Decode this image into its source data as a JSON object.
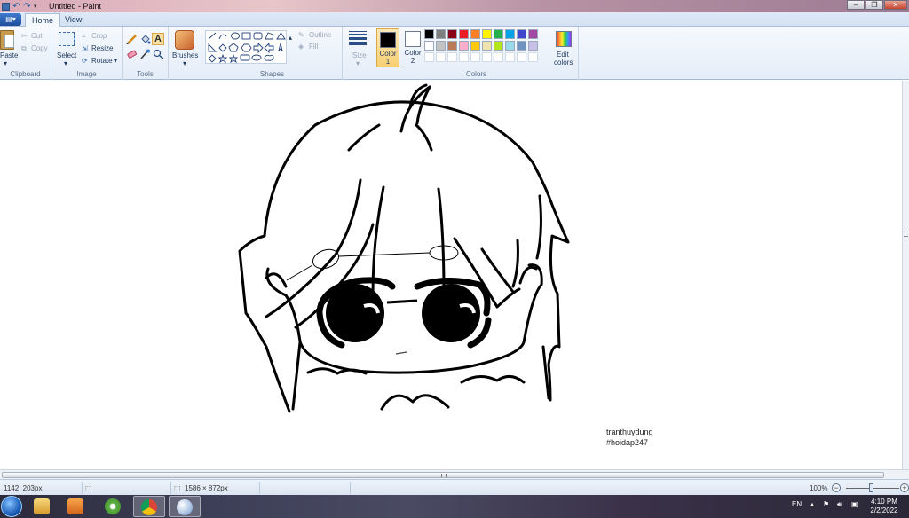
{
  "window": {
    "title": "Untitled - Paint"
  },
  "tabs": [
    {
      "label": "Home"
    },
    {
      "label": "View"
    }
  ],
  "ribbon": {
    "clipboard": {
      "paste": "Paste",
      "cut": "Cut",
      "copy": "Copy",
      "group": "Clipboard"
    },
    "image": {
      "select": "Select",
      "crop": "Crop",
      "resize": "Resize",
      "rotate": "Rotate",
      "group": "Image"
    },
    "tools": {
      "group": "Tools",
      "brushes": "Brushes"
    },
    "shapes": {
      "outline": "Outline",
      "fill": "Fill",
      "group": "Shapes"
    },
    "size": {
      "label": "Size"
    },
    "colors": {
      "color1": "Color",
      "color1_num": "1",
      "color2": "Color",
      "color2_num": "2",
      "edit": "Edit",
      "edit2": "colors",
      "group": "Colors",
      "color1_value": "#000000",
      "color2_value": "#ffffff",
      "palette_row1": [
        "#000000",
        "#7f7f7f",
        "#880015",
        "#ed1c24",
        "#ff7f27",
        "#fff200",
        "#22b14c",
        "#00a2e8",
        "#3f48cc",
        "#a349a4"
      ],
      "palette_row2": [
        "#ffffff",
        "#c3c3c3",
        "#b97a57",
        "#ffaec9",
        "#ffc90e",
        "#efe4b0",
        "#b5e61d",
        "#99d9ea",
        "#7092be",
        "#c8bfe7"
      ]
    }
  },
  "canvas": {
    "signature_line1": "tranthuydung",
    "signature_line2": "#hoidap247"
  },
  "status": {
    "cursor": "1142, 203px",
    "canvas_size": "1586 × 872px",
    "zoom": "100%"
  },
  "taskbar": {
    "lang": "EN",
    "time": "4:10 PM",
    "date": "2/2/2022"
  }
}
